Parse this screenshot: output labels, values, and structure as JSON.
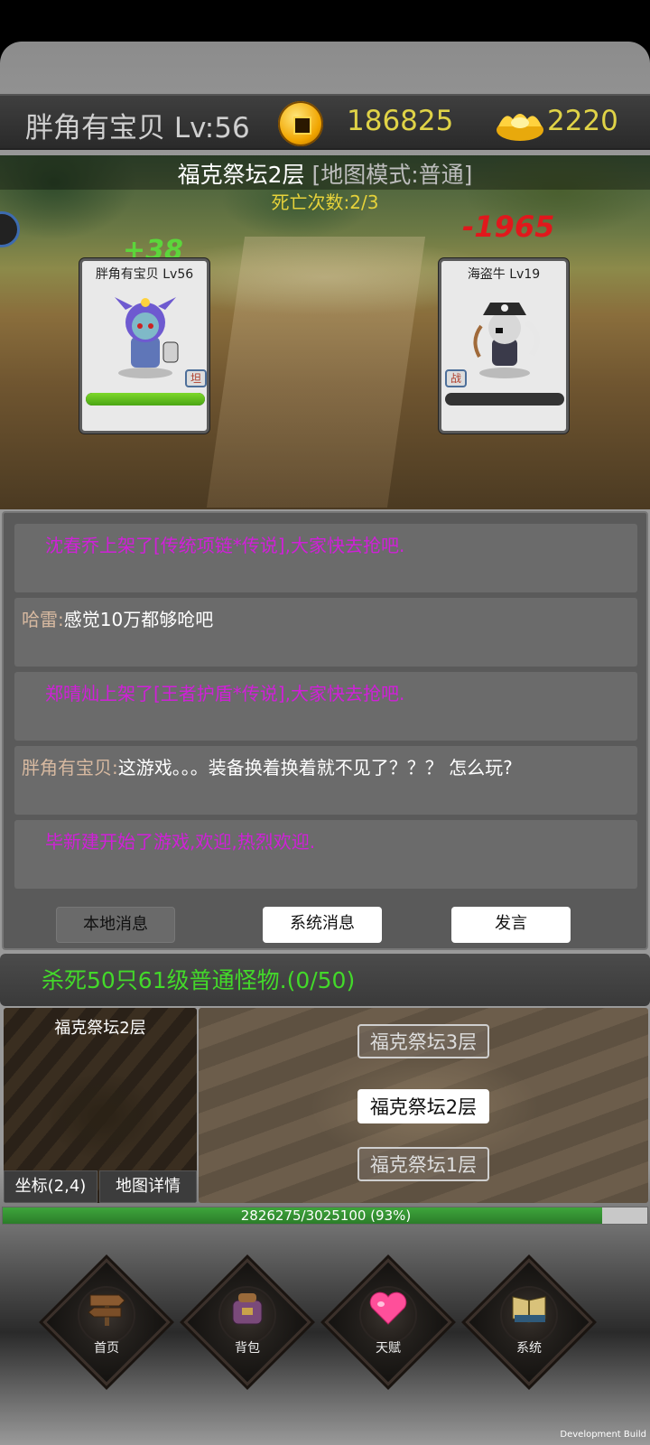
{
  "header": {
    "player": "胖角有宝贝 Lv:56",
    "gold": "186825",
    "ingots": "2220",
    "icons": {
      "gold": "copper-coin-icon",
      "ingot": "gold-ingot-icon"
    }
  },
  "battle": {
    "map_name": "福克祭坛2层",
    "map_mode": "[地图模式:普通]",
    "deaths": "死亡次数:2/3",
    "damage": "-1965",
    "heal": "+38",
    "player_card": {
      "label": "胖角有宝贝 Lv56",
      "role": "坦",
      "hp_fraction": 1.0
    },
    "enemy_card": {
      "label": "海盗牛 Lv19",
      "role": "战",
      "hp_fraction": 0.0
    }
  },
  "chat": {
    "messages": [
      {
        "type": "system",
        "text": "沈春乔上架了[传统项链*传说],大家快去抢吧."
      },
      {
        "type": "player",
        "speaker": "哈雷:",
        "text": "感觉10万都够呛吧"
      },
      {
        "type": "system",
        "text": "郑晴灿上架了[王者护盾*传说],大家快去抢吧."
      },
      {
        "type": "player",
        "speaker": "胖角有宝贝:",
        "text": "这游戏。。。装备换着换着就不见了？？？ 怎么玩?"
      },
      {
        "type": "system",
        "text": "毕新建开始了游戏,欢迎,热烈欢迎."
      }
    ],
    "buttons": {
      "local": "本地消息",
      "system": "系统消息",
      "speak": "发言"
    }
  },
  "quest": {
    "text": "杀死50只61级普通怪物.(0/50)"
  },
  "map": {
    "current_name": "福克祭坛2层",
    "coords": "坐标(2,4)",
    "details": "地图详情",
    "floors": [
      "福克祭坛3层",
      "福克祭坛2层",
      "福克祭坛1层"
    ],
    "current_floor_index": 1
  },
  "exp": {
    "text": "2826275/3025100 (93%)",
    "fraction": 0.93
  },
  "nav": {
    "items": [
      {
        "label": "首页",
        "icon": "signpost-icon"
      },
      {
        "label": "背包",
        "icon": "bag-icon"
      },
      {
        "label": "天赋",
        "icon": "heart-icon"
      },
      {
        "label": "系统",
        "icon": "book-icon"
      }
    ]
  },
  "footer": {
    "build": "Development Build"
  },
  "colors": {
    "gold_text": "#e0d347",
    "quest_green": "#43d92a",
    "system_msg": "#d020d8",
    "damage_red": "#e0181c",
    "heal_green": "#59e03a"
  }
}
